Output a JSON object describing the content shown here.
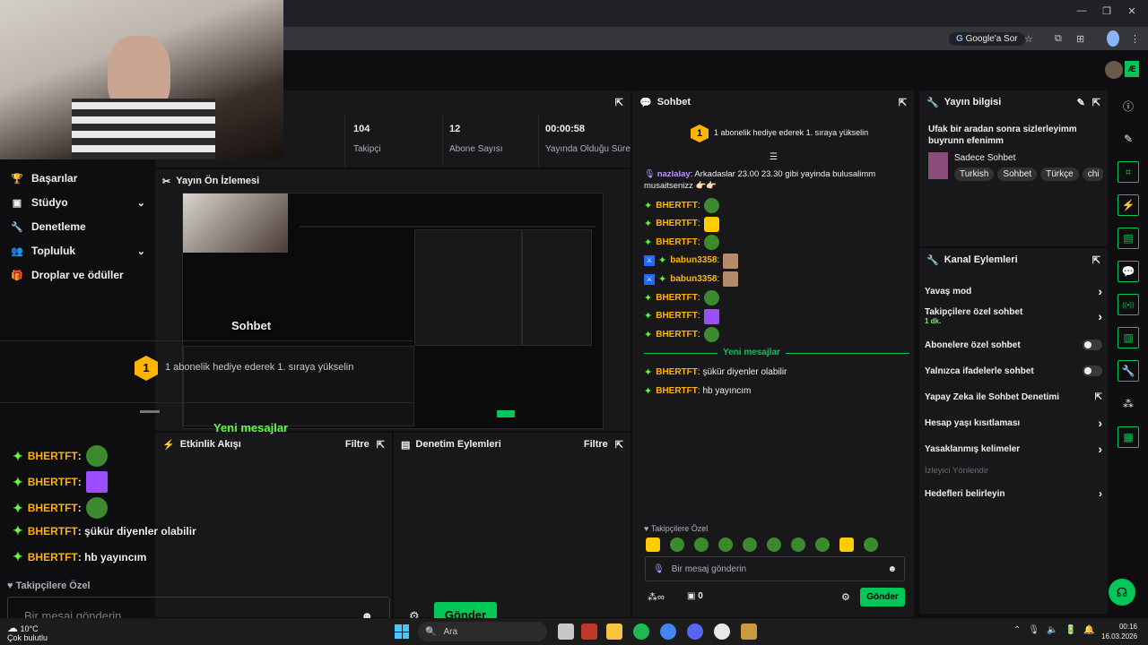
{
  "browser": {
    "google_pill": "Google'a Sor"
  },
  "stats": [
    {
      "value": "104",
      "label": "Takipçi"
    },
    {
      "value": "12",
      "label": "Abone Sayısı"
    },
    {
      "value": "00:00:58",
      "label": "Yayında Olduğu Süre"
    }
  ],
  "stats_partial_label": "i",
  "sidebar": {
    "items": [
      {
        "label": "Başarılar",
        "icon": "trophy-icon",
        "chevron": false
      },
      {
        "label": "Stüdyo",
        "icon": "video-icon",
        "chevron": true
      },
      {
        "label": "Denetleme",
        "icon": "wrench-icon",
        "chevron": false
      },
      {
        "label": "Topluluk",
        "icon": "people-icon",
        "chevron": true
      },
      {
        "label": "Droplar ve ödüller",
        "icon": "gift-icon",
        "chevron": false
      }
    ]
  },
  "preview": {
    "title": "Yayın Ön İzlemesi"
  },
  "activity": {
    "title": "Etkinlik Akışı",
    "filter": "Filtre"
  },
  "moderation": {
    "title": "Denetim Eylemleri",
    "filter": "Filtre"
  },
  "chat": {
    "title": "Sohbet",
    "hype_rank": "1",
    "hype_text": "1 abonelik hediye ederek 1. sıraya yükselin",
    "first_msg_user": "nazlalay",
    "first_msg_text": ": Arkadaslar 23.00 23.30 gibi yayinda bulusalimm musaitsenizz 👉🏻👉🏻",
    "messages": [
      {
        "user": "BHERTFT",
        "sep": ":",
        "emote": "pepe"
      },
      {
        "user": "BHERTFT",
        "sep": ":",
        "emote": "cat"
      },
      {
        "user": "BHERTFT",
        "sep": ":",
        "emote": "pepe"
      },
      {
        "user": "babun3358",
        "sep": ":",
        "emote": "dog",
        "mod": true
      },
      {
        "user": "babun3358",
        "sep": ":",
        "emote": "dog",
        "mod": true
      },
      {
        "user": "BHERTFT",
        "sep": ":",
        "emote": "pepe"
      },
      {
        "user": "BHERTFT",
        "sep": ":",
        "emote": "bars"
      },
      {
        "user": "BHERTFT",
        "sep": ":",
        "emote": "pepe"
      }
    ],
    "new_messages": "Yeni mesajlar",
    "after": [
      {
        "user": "BHERTFT",
        "text": ": şükür diyenler olabilir"
      },
      {
        "user": "BHERTFT",
        "text": ": hb yayıncım"
      }
    ],
    "followers_only": "Takipçilere Özel",
    "input_placeholder": "Bir mesaj gönderin",
    "points": "0",
    "send": "Gönder"
  },
  "stream_info": {
    "title": "Yayın bilgisi",
    "stream_title": "Ufak bir aradan sonra sizlerleyimm buyrunn efenimm",
    "category": "Sadece Sohbet",
    "tags": [
      "Turkish",
      "Sohbet",
      "Türkçe",
      "chi"
    ]
  },
  "channel_actions": {
    "title": "Kanal Eylemleri",
    "rows": [
      {
        "label": "Yavaş mod",
        "control": "chevron"
      },
      {
        "label": "Takipçilere özel sohbet",
        "sub": "1 dk.",
        "control": "chevron"
      },
      {
        "label": "Abonelere özel sohbet",
        "control": "toggle"
      },
      {
        "label": "Yalnızca ifadelerle sohbet",
        "control": "toggle"
      },
      {
        "label": "Yapay Zeka ile Sohbet Denetimi",
        "control": "external"
      },
      {
        "label": "Hesap yaşı kısıtlaması",
        "control": "chevron"
      },
      {
        "label": "Yasaklanmış kelimeler",
        "control": "chevron"
      }
    ],
    "viewer_directed": "İzleyici Yönlendir",
    "goals": "Hedefleri belirleyin"
  },
  "overlay": {
    "chat_title": "Sohbet",
    "hype_text": "1 abonelik hediye ederek 1. sıraya yükselin",
    "new_messages": "Yeni mesajlar",
    "lines": [
      {
        "user": "BHERTFT",
        "sep": ":",
        "emote": "pepe"
      },
      {
        "user": "BHERTFT",
        "sep": ":",
        "emote": "bars"
      },
      {
        "user": "BHERTFT",
        "sep": ":",
        "emote": "pepe"
      },
      {
        "user": "BHERTFT",
        "text": ": şükür diyenler olabilir"
      },
      {
        "user": "BHERTFT",
        "text": ": hb yayıncım"
      }
    ],
    "followers_only": "Takipçilere Özel",
    "input_placeholder": "Bir mesaj gönderin",
    "send": "Gönder"
  },
  "taskbar": {
    "weather_temp": "10°C",
    "weather_desc": "Çok bulutlu",
    "search": "Ara",
    "time": "00:16",
    "date": "16.03.2026"
  },
  "colors": {
    "accent": "#00c758",
    "username": "#ffb400",
    "background": "#0e0e10",
    "panel": "#18181b"
  }
}
